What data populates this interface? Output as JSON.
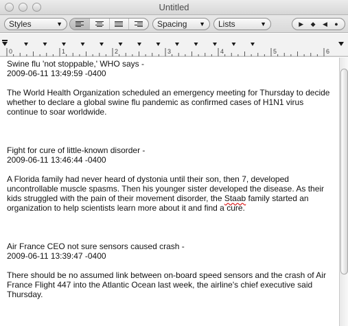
{
  "window": {
    "title": "Untitled"
  },
  "toolbar": {
    "styles_label": "Styles",
    "spacing_label": "Spacing",
    "lists_label": "Lists",
    "dropdown_arrow": "▼",
    "alignment_selected": "left",
    "nav_symbols": [
      "▶",
      "◆",
      "◀",
      "●"
    ]
  },
  "ruler": {
    "labels": [
      "0",
      "1",
      "2",
      "3",
      "4",
      "5",
      "6"
    ]
  },
  "articles": [
    {
      "headline": "Swine flu 'not stoppable,' WHO says -",
      "date": "2009-06-11 13:49:59 -0400",
      "body": "The World Health Organization scheduled an emergency meeting for Thursday to decide whether to declare a global swine flu pandemic as confirmed cases of H1N1 virus continue to soar worldwide."
    },
    {
      "headline": "Fight for cure of little-known disorder -",
      "date": "2009-06-11 13:46:44 -0400",
      "body_before": "A Florida family had never heard of dystonia until their son, then 7, developed uncontrollable muscle spasms. Then his younger sister developed the disease. As their kids struggled with the pain of their movement disorder, the ",
      "body_misspelled": "Staab",
      "body_after": " family started an organization to help scientists learn more about it and find a cure."
    },
    {
      "headline": "Air France CEO not sure sensors caused crash -",
      "date": "2009-06-11 13:39:47 -0400",
      "body": "There should be no assumed link between on-board speed sensors and the crash of Air France Flight 447 into the Atlantic Ocean last week, the airline's chief executive said Thursday."
    }
  ],
  "colors": {
    "spellcheck_underline": "#d22222",
    "ruler_marker": "#1a1a1a"
  }
}
